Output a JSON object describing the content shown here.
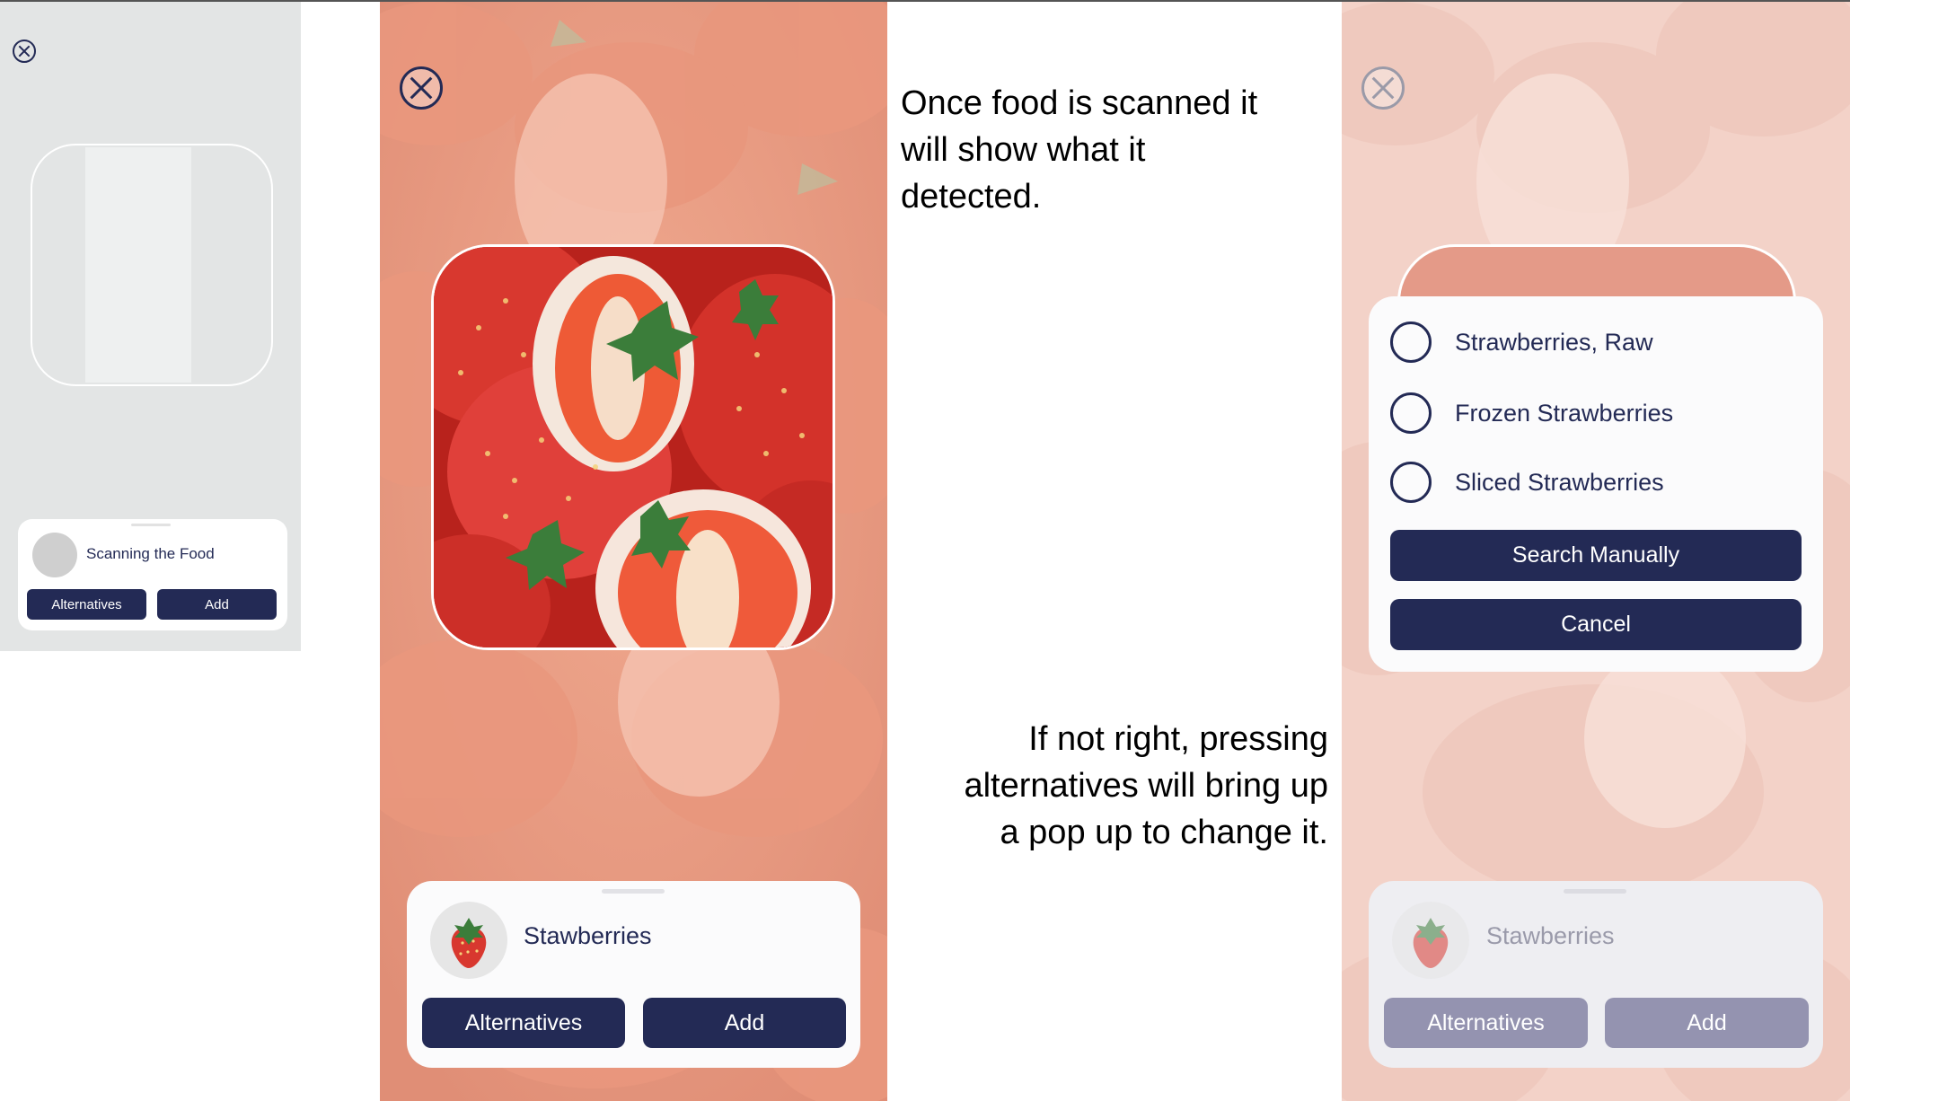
{
  "screen1": {
    "close_icon": "close-icon",
    "status_text": "Scanning the Food",
    "alternatives_label": "Alternatives",
    "add_label": "Add"
  },
  "screen2": {
    "close_icon": "close-icon",
    "detected_food": "Stawberries",
    "food_thumbnail": "strawberry-icon",
    "alternatives_label": "Alternatives",
    "add_label": "Add"
  },
  "annotations": {
    "note1_line1": "Once food is scanned it",
    "note1_line2": "will show what it",
    "note1_line3": "detected.",
    "note2_line1": "If not right, pressing",
    "note2_line2": "alternatives will bring up",
    "note2_line3": "a pop up to change it."
  },
  "screen3": {
    "close_icon": "close-icon",
    "options": [
      {
        "label": "Strawberries, Raw"
      },
      {
        "label": "Frozen Strawberries"
      },
      {
        "label": "Sliced Strawberries"
      }
    ],
    "search_manually_label": "Search Manually",
    "cancel_label": "Cancel",
    "detected_food": "Stawberries",
    "alternatives_label": "Alternatives",
    "add_label": "Add"
  },
  "colors": {
    "primary": "#232a55",
    "placeholder_bg": "#e3e5e5",
    "strawberry_red": "#d8382f",
    "muted_button": "#9493b0"
  }
}
